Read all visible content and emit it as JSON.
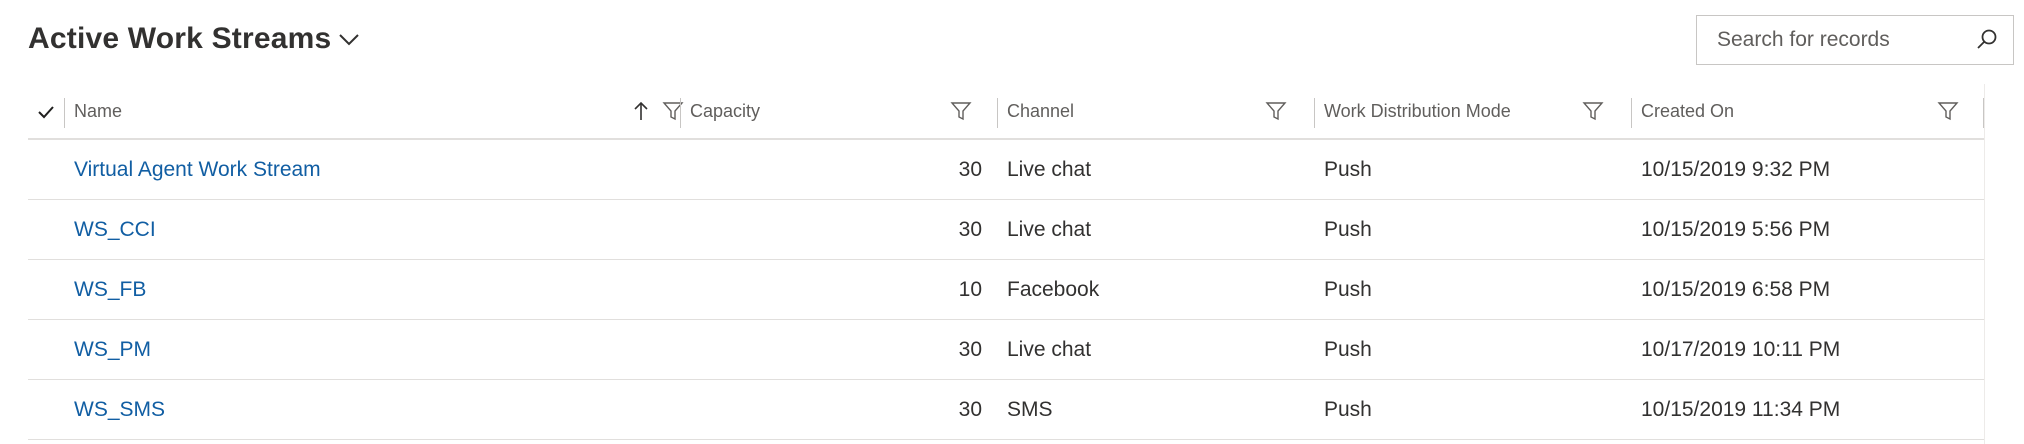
{
  "view": {
    "title": "Active Work Streams"
  },
  "search": {
    "placeholder": "Search for records",
    "value": ""
  },
  "columns": [
    {
      "label": "Name",
      "sort": "ascending",
      "filter": true
    },
    {
      "label": "Capacity",
      "filter": true
    },
    {
      "label": "Channel",
      "filter": true
    },
    {
      "label": "Work Distribution Mode",
      "filter": true
    },
    {
      "label": "Created On",
      "filter": true
    }
  ],
  "rows": [
    {
      "name": "Virtual Agent Work Stream",
      "capacity": "30",
      "channel": "Live chat",
      "mode": "Push",
      "created": "10/15/2019 9:32 PM"
    },
    {
      "name": "WS_CCI",
      "capacity": "30",
      "channel": "Live chat",
      "mode": "Push",
      "created": "10/15/2019 5:56 PM"
    },
    {
      "name": "WS_FB",
      "capacity": "10",
      "channel": "Facebook",
      "mode": "Push",
      "created": "10/15/2019 6:58 PM"
    },
    {
      "name": "WS_PM",
      "capacity": "30",
      "channel": "Live chat",
      "mode": "Push",
      "created": "10/17/2019 10:11 PM"
    },
    {
      "name": "WS_SMS",
      "capacity": "30",
      "channel": "SMS",
      "mode": "Push",
      "created": "10/15/2019 11:34 PM"
    }
  ],
  "icons": {
    "view_selector": "chevron-down-icon",
    "search": "search-icon",
    "select_all": "checkmark-icon",
    "sort": "sort-ascending-arrow-icon",
    "filter": "filter-icon"
  },
  "colors": {
    "link": "#115ea3",
    "text": "#323130",
    "header_text": "#605e5c",
    "border": "#e1dfdd"
  }
}
